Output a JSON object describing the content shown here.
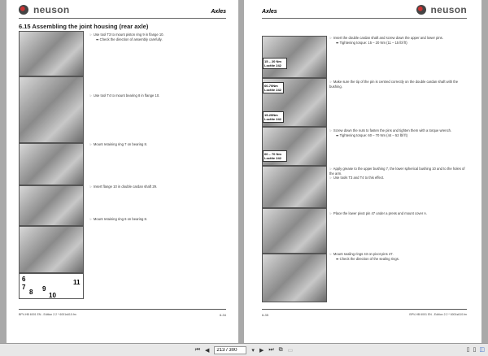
{
  "left_page": {
    "brand": "neuson",
    "section": "Axles",
    "heading": "6.15   Assembling the joint housing (rear axle)",
    "steps": [
      {
        "text": "☞ Use tool T3 to mount piston ring 9 in flange 10.",
        "sub": "➡ Check the direction of assembly carefully."
      },
      {
        "text": "☞ Use tool T4 to mount bearing 8 in flange 10."
      },
      {
        "text": "☞ Mount retaining ring 7 on bearing 8."
      },
      {
        "text": "☞ Insert flange 10 in double cardan shaft 29."
      },
      {
        "text": "☞ Mount retaining ring 6 on bearing 8."
      }
    ],
    "diagram_numbers": [
      "6",
      "7",
      "8",
      "9",
      "10",
      "11"
    ],
    "footer_left": "BPV-HB 6001 EN - Edition 2.2 * 6001s610.fm",
    "page_number": "6-34"
  },
  "right_page": {
    "brand": "neuson",
    "section": "Axles",
    "steps": [
      {
        "text": "☞ Insert the double cardan shaft and screw down the upper and lower pins.",
        "sub": "➡ Tightening torque: 15 – 20 Nm (11 – 15 lbf ft)"
      },
      {
        "text": "☞ Make sure the tip of the pin is centred correctly on the double cardan shaft with the bushing."
      },
      {
        "text": "☞ Screw down the nuts to fasten the pins and tighten them with a torque wrench.",
        "sub": "➡ Tightening torque: 60 – 70 Nm (44 – 52 lbf ft)"
      },
      {
        "text": "☞ Apply grease to the upper bushing 7, the lower spherical bushing 10 and to the holes of the arm.",
        "text2": "☞ Use tools T3 and T4 to this effect."
      },
      {
        "text": "☞ Place the lower pivot pin 47 under a press and mount cover A."
      },
      {
        "text": "☞ Mount sealing rings 43 on pivot pins 47.",
        "sub": "➡ Check the direction of the sealing rings."
      }
    ],
    "labels": [
      "15 – 20 Nm Loctite 242",
      "60-70Nm Loctite 242",
      "15-20Nm Loctite 242",
      "60 – 70 Nm Loctite 242"
    ],
    "page_number": "6-35",
    "footer_right": "BPV-HB 6001 EN - Edition 2.2 * 6001s610.fm"
  },
  "toolbar": {
    "page_value": "213 / 300"
  }
}
